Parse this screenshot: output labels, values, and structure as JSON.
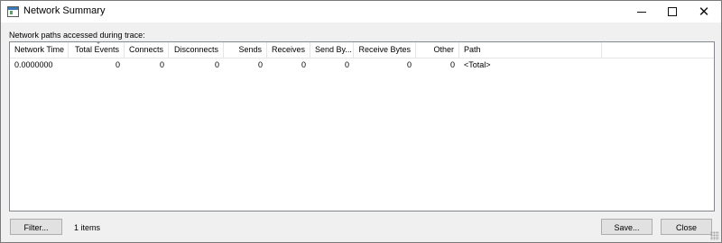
{
  "window": {
    "title": "Network Summary",
    "controls": {
      "minimize": "minimize",
      "maximize": "maximize",
      "close": "close"
    }
  },
  "section_label": "Network paths accessed during trace:",
  "table": {
    "columns": [
      {
        "label": "Network Time",
        "align": "left"
      },
      {
        "label": "Total Events",
        "align": "right"
      },
      {
        "label": "Connects",
        "align": "right"
      },
      {
        "label": "Disconnects",
        "align": "right"
      },
      {
        "label": "Sends",
        "align": "right"
      },
      {
        "label": "Receives",
        "align": "right"
      },
      {
        "label": "Send By...",
        "align": "right"
      },
      {
        "label": "Receive Bytes",
        "align": "right"
      },
      {
        "label": "Other",
        "align": "right"
      },
      {
        "label": "Path",
        "align": "left"
      }
    ],
    "rows": [
      [
        "0.0000000",
        "0",
        "0",
        "0",
        "0",
        "0",
        "0",
        "0",
        "0",
        "<Total>"
      ]
    ]
  },
  "footer": {
    "filter_label": "Filter...",
    "items_count": "1 items",
    "save_label": "Save...",
    "close_label": "Close"
  }
}
